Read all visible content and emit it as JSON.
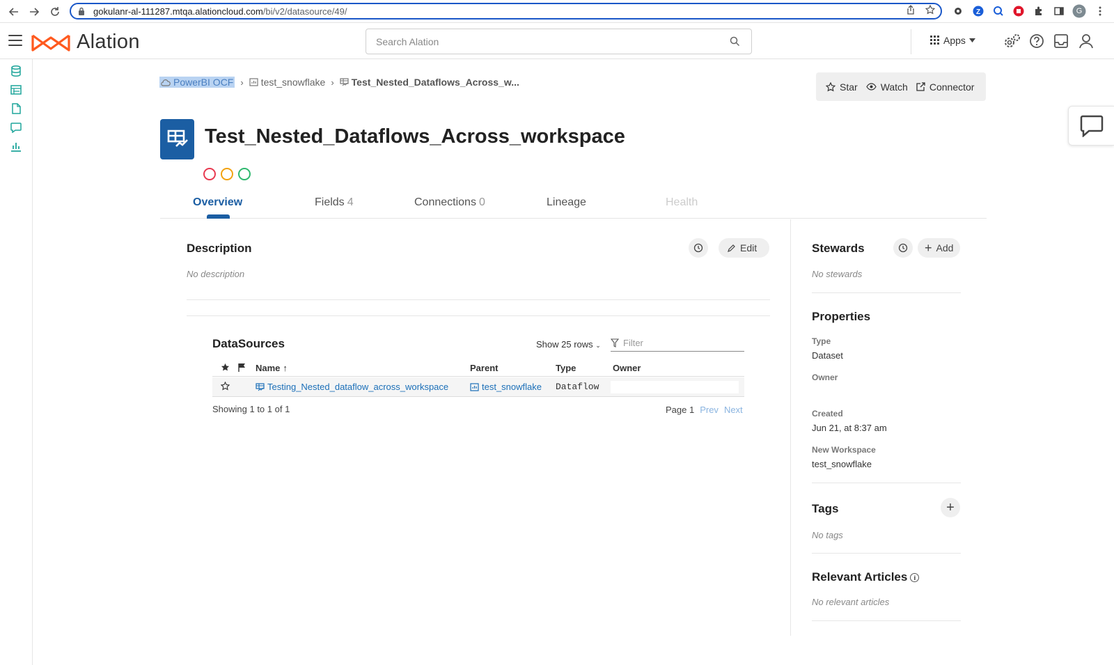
{
  "browser": {
    "url_host": "gokulanr-al-111287.mtqa.alationcloud.com",
    "url_path": "/bi/v2/datasource/49/",
    "profile_initial": "G"
  },
  "header": {
    "logo_text": "Alation",
    "search_placeholder": "Search Alation",
    "apps_label": "Apps"
  },
  "breadcrumb": {
    "items": [
      {
        "label": "PowerBI OCF",
        "icon": "cloud-icon"
      },
      {
        "label": "test_snowflake",
        "icon": "bi-folder-icon"
      },
      {
        "label": "Test_Nested_Dataflows_Across_w...",
        "icon": "dataflow-icon"
      }
    ]
  },
  "actions": {
    "star": "Star",
    "watch": "Watch",
    "connector": "Connector"
  },
  "object": {
    "title": "Test_Nested_Dataflows_Across_workspace",
    "trust_flags": [
      {
        "color": "#e8384f"
      },
      {
        "color": "#f2a20f"
      },
      {
        "color": "#2eb86e"
      }
    ]
  },
  "tabs": [
    {
      "label": "Overview",
      "count": ""
    },
    {
      "label": "Fields",
      "count": "4"
    },
    {
      "label": "Connections",
      "count": "0"
    },
    {
      "label": "Lineage",
      "count": ""
    },
    {
      "label": "Health",
      "count": ""
    }
  ],
  "description": {
    "title": "Description",
    "empty": "No description",
    "edit_label": "Edit"
  },
  "datasources": {
    "title": "DataSources",
    "show_rows": "Show 25 rows",
    "filter_placeholder": "Filter",
    "columns": {
      "name": "Name",
      "parent": "Parent",
      "type": "Type",
      "owner": "Owner"
    },
    "rows": [
      {
        "name": "Testing_Nested_dataflow_across_workspace",
        "parent": "test_snowflake",
        "type": "Dataflow",
        "owner": ""
      }
    ],
    "showing": "Showing 1 to 1 of 1",
    "page": "Page 1",
    "prev": "Prev",
    "next": "Next"
  },
  "stewards": {
    "title": "Stewards",
    "add_label": "Add",
    "empty": "No stewards"
  },
  "properties": {
    "title": "Properties",
    "type_label": "Type",
    "type_value": "Dataset",
    "owner_label": "Owner",
    "owner_value": "",
    "created_label": "Created",
    "created_value": "Jun 21, at 8:37 am",
    "workspace_label": "New Workspace",
    "workspace_value": "test_snowflake"
  },
  "tags": {
    "title": "Tags",
    "empty": "No tags"
  },
  "articles": {
    "title": "Relevant Articles",
    "empty": "No relevant articles"
  },
  "colors": {
    "brand": "#ff5a1f",
    "accent": "#1b5ea3",
    "link": "#1b6fb8",
    "nav_icon": "#1fa59b"
  }
}
